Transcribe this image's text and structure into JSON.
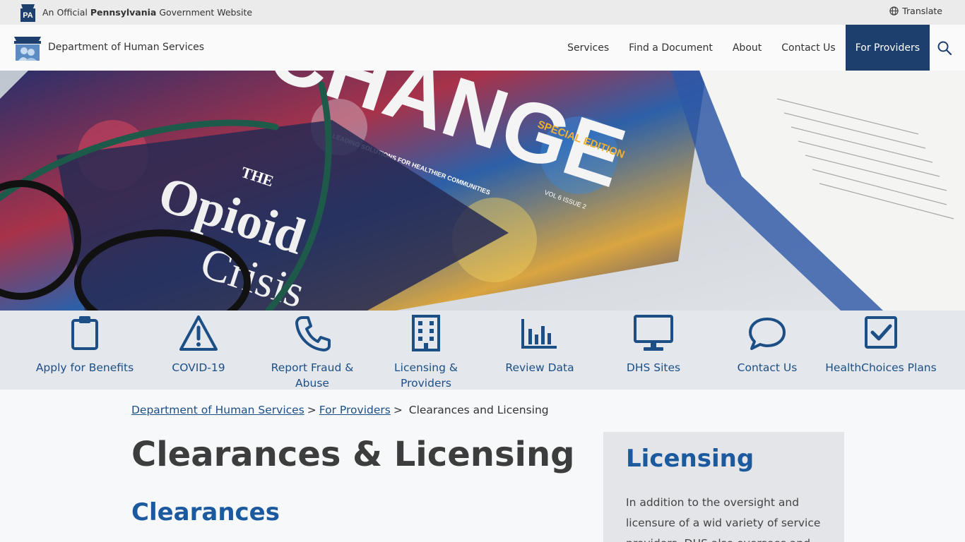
{
  "official_bar": {
    "badge_text": "PA",
    "prefix": "An Official ",
    "state": "Pennsylvania",
    "suffix": " Government Website",
    "translate_label": "Translate"
  },
  "header": {
    "department": "Department of Human Services",
    "nav": [
      {
        "label": "Services"
      },
      {
        "label": "Find a Document"
      },
      {
        "label": "About"
      },
      {
        "label": "Contact Us"
      },
      {
        "label": "For Providers",
        "active": true
      }
    ]
  },
  "hero": {
    "magazine_word": "CHANGE",
    "special_edition": "SPECIAL EDITION",
    "tagline": "LEADING SOLUTIONS FOR HEALTHIER COMMUNITIES",
    "issue": "VOL 6 ISSUE 2",
    "cover_line1": "THE",
    "cover_line2": "Opioid",
    "cover_line3": "Crisis"
  },
  "quick_links": [
    {
      "label": "Apply for Benefits",
      "icon": "clipboard-icon"
    },
    {
      "label": "COVID-19",
      "icon": "warning-icon"
    },
    {
      "label": "Report Fraud & Abuse",
      "icon": "phone-icon"
    },
    {
      "label": "Licensing & Providers",
      "icon": "building-icon"
    },
    {
      "label": "Review Data",
      "icon": "bar-chart-icon"
    },
    {
      "label": "DHS Sites",
      "icon": "monitor-icon"
    },
    {
      "label": "Contact Us",
      "icon": "chat-bubble-icon"
    },
    {
      "label": "HealthChoices Plans",
      "icon": "checkbox-icon"
    }
  ],
  "breadcrumb": {
    "home": "Department of Human Services",
    "parent": "For Providers",
    "current": "Clearances and Licensing"
  },
  "main": {
    "title": "Clearances & Licensing",
    "section_title": "Clearances"
  },
  "sidebar": {
    "title": "Licensing",
    "text": "In addition to the oversight and licensure of a wid variety of service providers, DHS also oversees and"
  },
  "colors": {
    "brand_navy": "#1c3f6e",
    "link_blue": "#1c4f86",
    "heading_blue": "#1c5aa0"
  }
}
